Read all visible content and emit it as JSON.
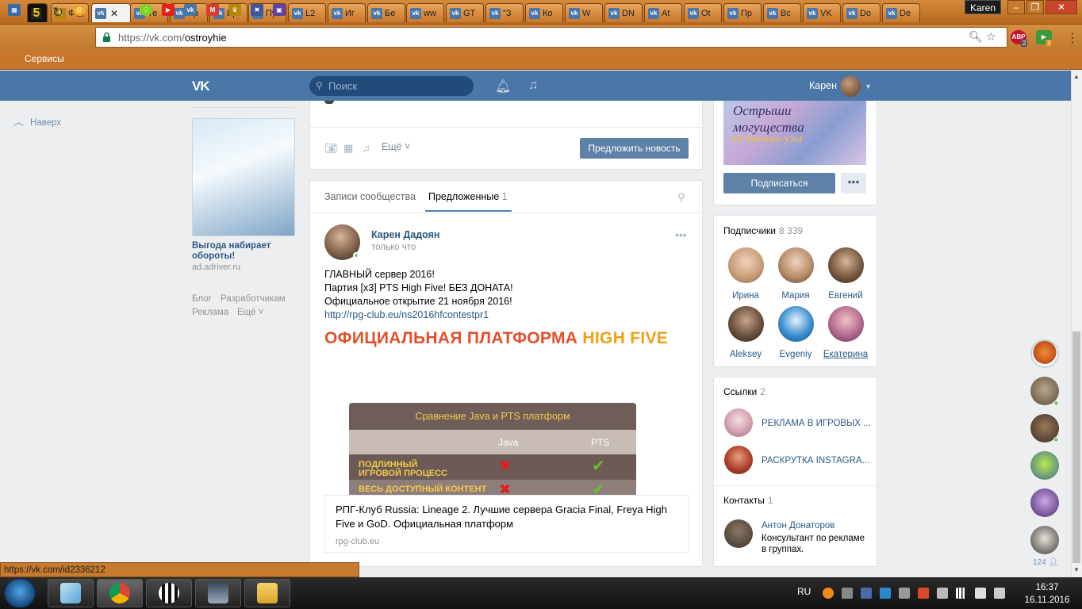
{
  "browser": {
    "tabs": [
      {
        "icon": "game-5-icon",
        "label": ""
      },
      {
        "icon": "coat-of-arms-icon",
        "label": "Ф"
      },
      {
        "icon": "vk-icon",
        "label": "",
        "active": true
      },
      {
        "icon": "vk-icon",
        "label": "Те"
      },
      {
        "icon": "vk-icon",
        "label": "Пр"
      },
      {
        "icon": "vk-icon",
        "label": "Бр"
      },
      {
        "icon": "vk-icon",
        "label": "Пу"
      },
      {
        "icon": "vk-icon",
        "label": "L2"
      },
      {
        "icon": "vk-icon",
        "label": "Иг"
      },
      {
        "icon": "vk-icon",
        "label": "Бе"
      },
      {
        "icon": "vk-icon",
        "label": "ww"
      },
      {
        "icon": "vk-icon",
        "label": "GT"
      },
      {
        "icon": "vk-icon",
        "label": "\"З"
      },
      {
        "icon": "vk-icon",
        "label": "Ко"
      },
      {
        "icon": "vk-icon",
        "label": "W"
      },
      {
        "icon": "vk-icon",
        "label": "DN"
      },
      {
        "icon": "vk-icon",
        "label": "At"
      },
      {
        "icon": "vk-icon",
        "label": "Ot"
      },
      {
        "icon": "vk-icon",
        "label": "Пр"
      },
      {
        "icon": "vk-icon",
        "label": "Вс"
      },
      {
        "icon": "vk-icon",
        "label": "VK"
      },
      {
        "icon": "vk-icon",
        "label": "Do"
      },
      {
        "icon": "vk-icon",
        "label": "De"
      }
    ],
    "user": "Karen",
    "url_scheme": "https://vk.com/",
    "url_path": "ostroyhie",
    "bookmarks_label": "Сервисы",
    "ext_abp_count": "2",
    "ext_green_count": "3",
    "status_url": "https://vk.com/id2336212",
    "accent": "#c8752c"
  },
  "vk": {
    "search_placeholder": "Поиск",
    "header_name": "Карен",
    "to_top": "Наверх",
    "ad": {
      "title": "Выгода набирает обороты!",
      "url": "ad.adriver.ru"
    },
    "footer": {
      "blog": "Блог",
      "dev": "Разработчикам",
      "ads": "Реклама",
      "more": "Ещё"
    },
    "composer": {
      "more": "Ещё",
      "suggest": "Предложить новость"
    },
    "feed": {
      "tab_posts": "Записи сообщества",
      "tab_suggested": "Предложенные",
      "tab_suggested_count": "1",
      "author": "Карен Дадоян",
      "time": "только что",
      "lines": [
        "ГЛАВНЫЙ сервер 2016!",
        "Партия [x3] PTS High Five! БЕЗ ДОНАТА!",
        "Официальное открытие 21 ноября 2016!"
      ],
      "link": "http://rpg-club.eu/ns2016hfcontestpr1",
      "banner_main": "ОФИЦИАЛЬНАЯ ПЛАТФОРМА",
      "banner_accent": "HIGH FIVE",
      "compare_title": "Сравнение Java и PTS платформ",
      "compare_col1": "Java",
      "compare_col2": "PTS",
      "compare_row1": "ПОДЛИННЫЙ ИГРОВОЙ ПРОЦЕСС",
      "compare_row2": "ВЕСЬ ДОСТУПНЫЙ КОНТЕНТ",
      "snippet_title": "РПГ-Клуб Russia: Lineage 2. Лучшие сервера Gracia Final, Freya High Five и GoD. Официальная платформ",
      "snippet_url": "rpg-club.eu"
    },
    "cover": {
      "line1": "Острыши",
      "line2": "могущества",
      "line3": "не только узы"
    },
    "subscribe": "Подписаться",
    "subscribers": {
      "title": "Подписчики",
      "count": "8 339",
      "people": [
        "Ирина",
        "Мария",
        "Евгений",
        "Aleksey",
        "Evgeniy",
        "Екатерина"
      ]
    },
    "links": {
      "title": "Ссылки",
      "count": "2",
      "items": [
        "РЕКЛАМА В ИГРОВЫХ ...",
        "РАСКРУТКА INSTAGRA..."
      ]
    },
    "contacts": {
      "title": "Контакты",
      "count": "1",
      "name": "Антон Донаторов",
      "role": "Консультант по рекламе в группах."
    },
    "friends_online_count": "124"
  },
  "taskbar": {
    "lang": "RU",
    "time": "16:37",
    "date": "16.11.2016"
  }
}
